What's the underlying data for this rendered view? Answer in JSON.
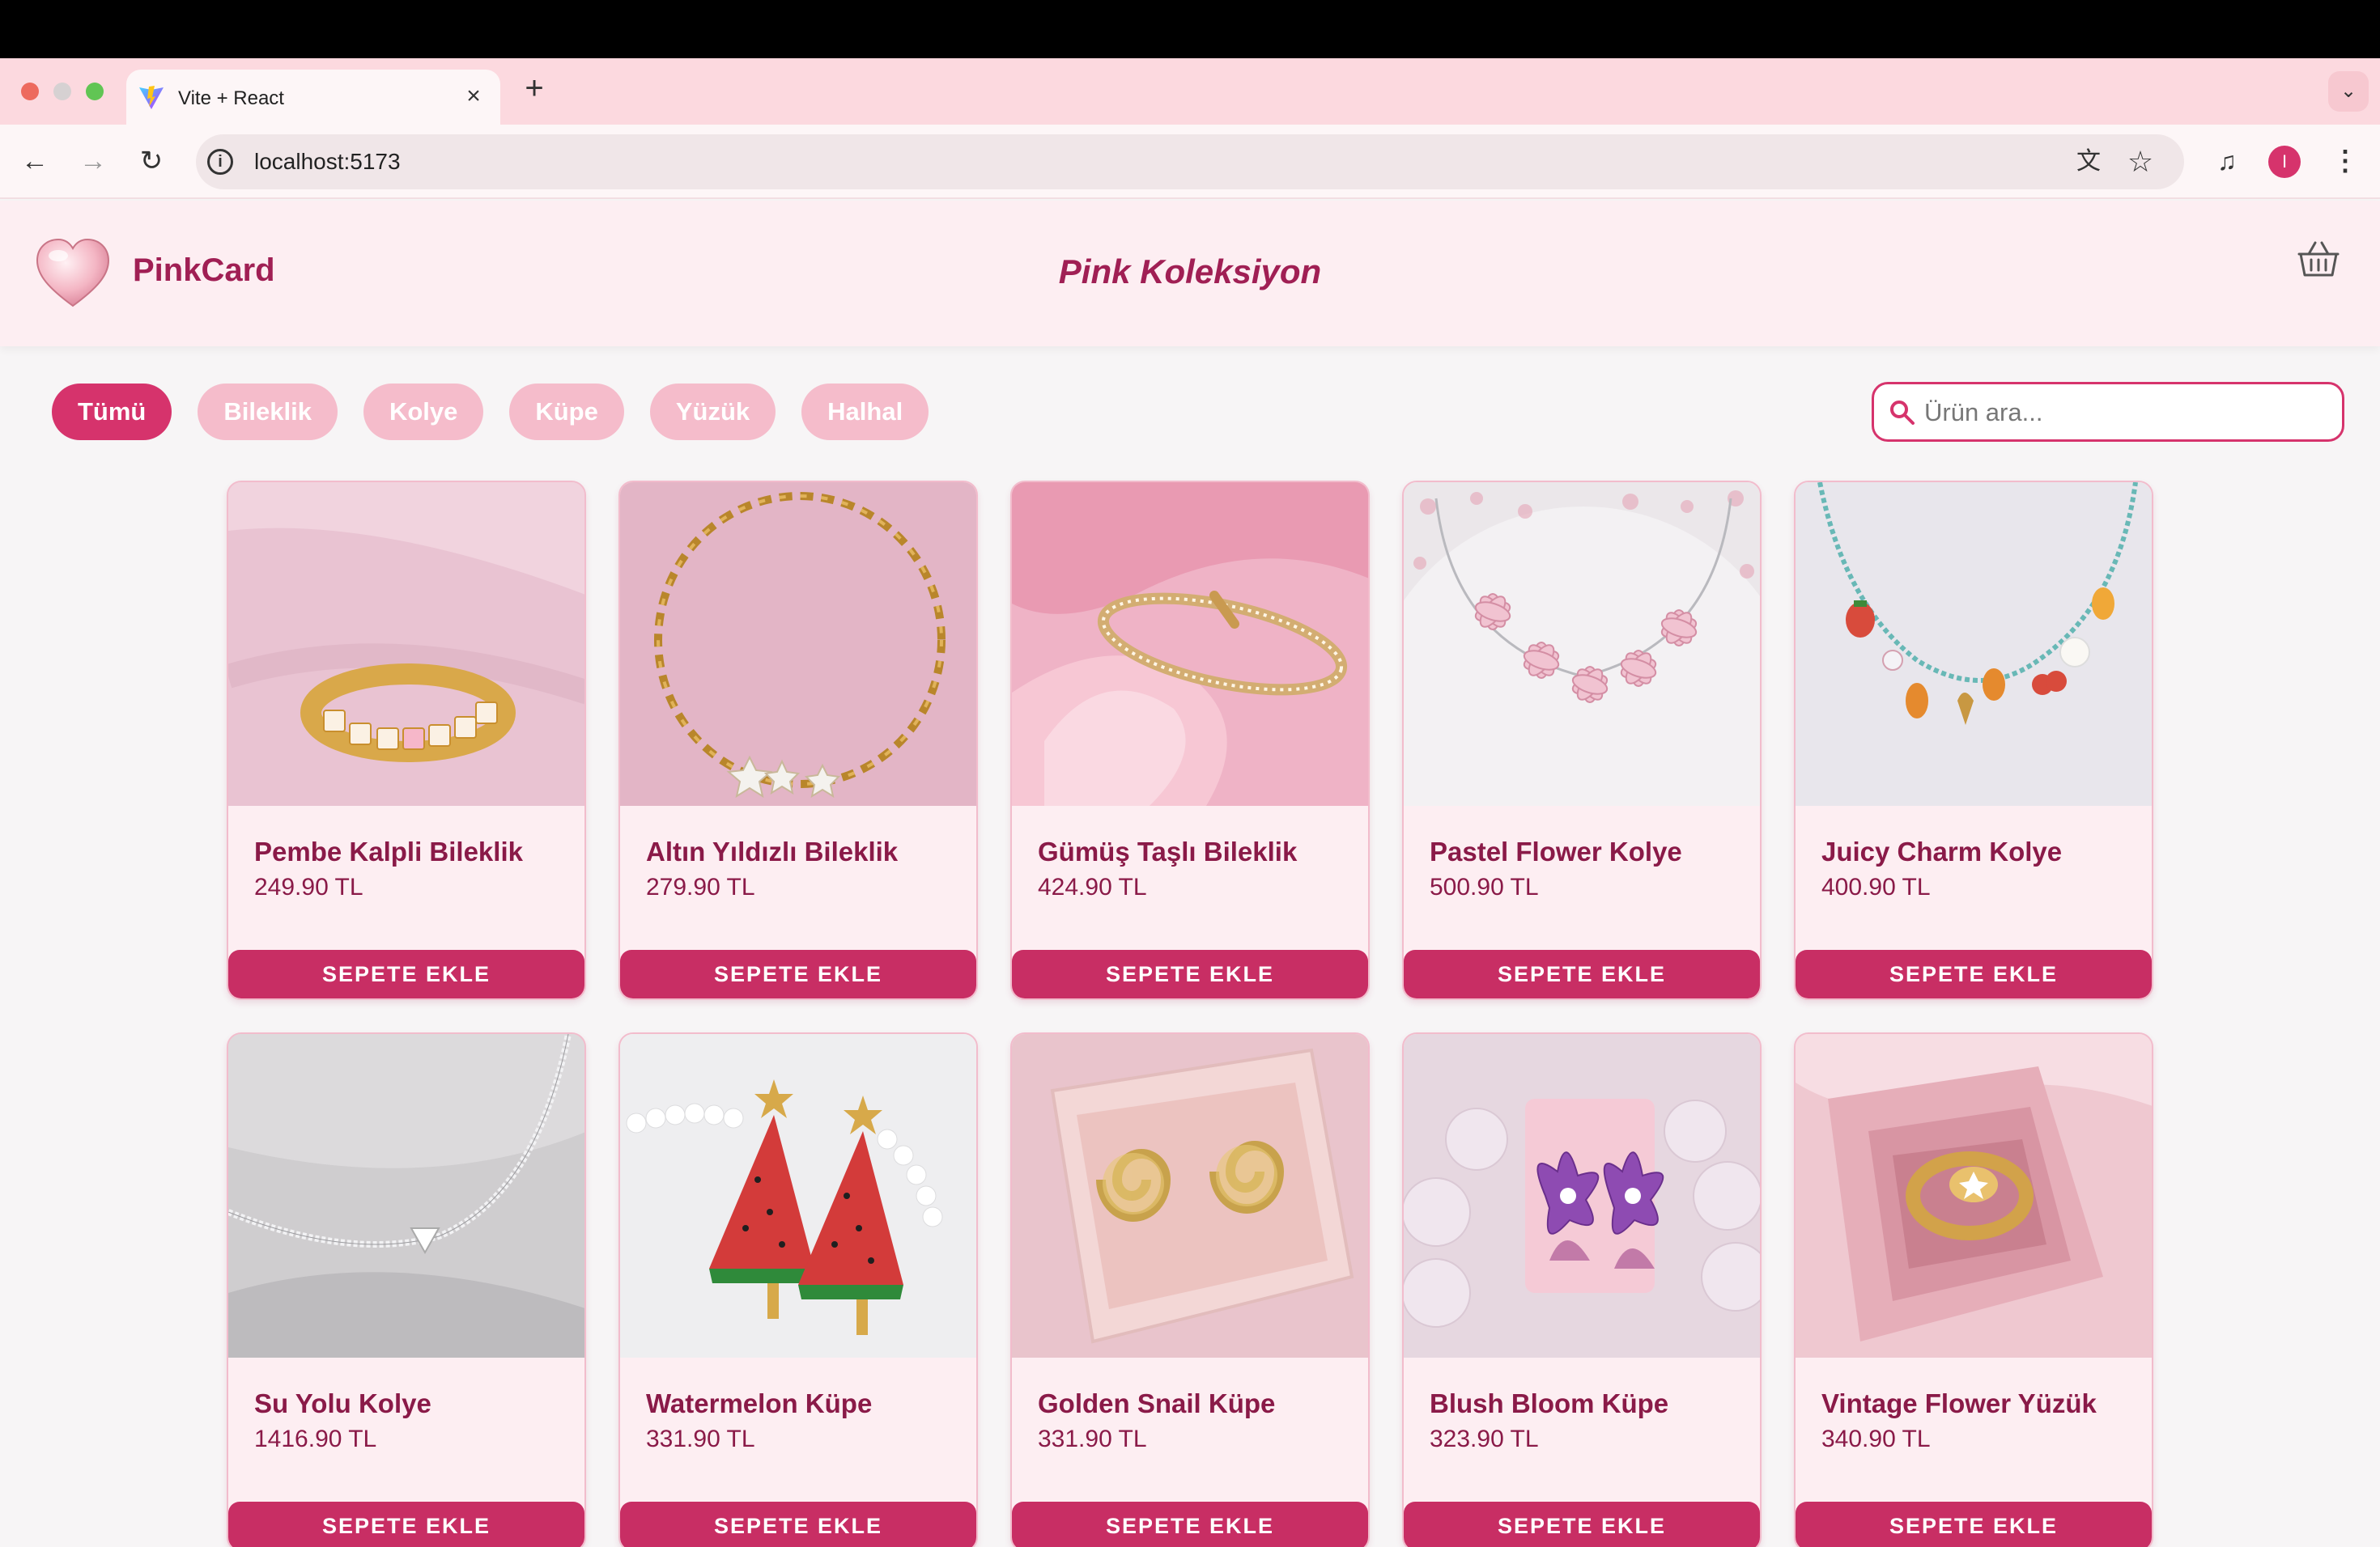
{
  "browser": {
    "tab_title": "Vite + React",
    "tab_close": "×",
    "new_tab": "+",
    "tab_dropdown": "⌄",
    "url": "localhost:5173",
    "info_symbol": "i",
    "back": "←",
    "forward": "→",
    "reload": "↻",
    "translate": "文",
    "bookmark": "☆",
    "media": "♫",
    "profile_initial": "I",
    "menu": "⋮"
  },
  "header": {
    "brand": "PinkCard",
    "title": "Pink Koleksiyon"
  },
  "filters": [
    {
      "label": "Tümü",
      "active": true
    },
    {
      "label": "Bileklik",
      "active": false
    },
    {
      "label": "Kolye",
      "active": false
    },
    {
      "label": "Küpe",
      "active": false
    },
    {
      "label": "Yüzük",
      "active": false
    },
    {
      "label": "Halhal",
      "active": false
    }
  ],
  "search": {
    "placeholder": "Ürün ara..."
  },
  "products": [
    {
      "name": "Pembe Kalpli Bileklik",
      "price": "249.90 TL",
      "button": "SEPETE EKLE",
      "image_bg": "#e9c3d2"
    },
    {
      "name": "Altın Yıldızlı Bileklik",
      "price": "279.90 TL",
      "button": "SEPETE EKLE",
      "image_bg": "#e3b5c6"
    },
    {
      "name": "Gümüş Taşlı Bileklik",
      "price": "424.90 TL",
      "button": "SEPETE EKLE",
      "image_bg": "#efb3c6"
    },
    {
      "name": "Pastel Flower Kolye",
      "price": "500.90 TL",
      "button": "SEPETE EKLE",
      "image_bg": "#ebe7ea"
    },
    {
      "name": "Juicy Charm Kolye",
      "price": "400.90 TL",
      "button": "SEPETE EKLE",
      "image_bg": "#e8e6ec"
    },
    {
      "name": "Su Yolu Kolye",
      "price": "1416.90 TL",
      "button": "SEPETE EKLE",
      "image_bg": "#cfcdcf"
    },
    {
      "name": "Watermelon Küpe",
      "price": "331.90 TL",
      "button": "SEPETE EKLE",
      "image_bg": "#eeeef0"
    },
    {
      "name": "Golden Snail Küpe",
      "price": "331.90 TL",
      "button": "SEPETE EKLE",
      "image_bg": "#e9c4cc"
    },
    {
      "name": "Blush Bloom Küpe",
      "price": "323.90 TL",
      "button": "SEPETE EKLE",
      "image_bg": "#e6d7e0"
    },
    {
      "name": "Vintage Flower Yüzük",
      "price": "340.90 TL",
      "button": "SEPETE EKLE",
      "image_bg": "#efc8d0"
    }
  ],
  "colors": {
    "accent": "#d6336c",
    "chip_inactive": "#f5bccb",
    "text_brand": "#a01f54",
    "header_bg": "#fdeef2",
    "tab_strip_bg": "#fcd9df"
  }
}
